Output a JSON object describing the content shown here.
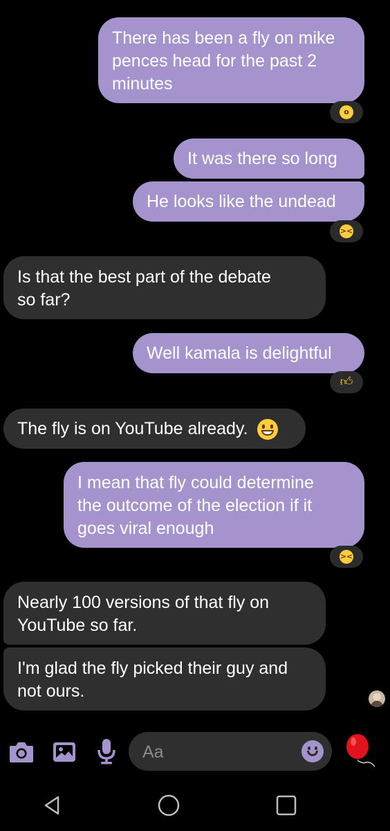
{
  "messages": [
    {
      "lines": [
        "There has been a fly on mike",
        "pences head for the past 2",
        "minutes"
      ],
      "reaction": "astonished-face"
    },
    {
      "lines": [
        "It was there so long"
      ]
    },
    {
      "lines": [
        "He looks like the undead"
      ],
      "reaction": "laughing-face"
    },
    {
      "lines": [
        "Is that the best part of the debate",
        "so far?"
      ]
    },
    {
      "lines": [
        "Well kamala is delightful"
      ],
      "reaction": "thumbs-up"
    },
    {
      "lines": [
        "The fly is on YouTube already. "
      ],
      "emoji": "grinning-face"
    },
    {
      "lines": [
        "I mean that fly could determine",
        "the outcome of the election if it",
        "goes viral enough"
      ],
      "reaction": "laughing-face"
    },
    {
      "lines": [
        "Nearly 100 versions of that fly on",
        "YouTube so far."
      ]
    },
    {
      "lines": [
        "I'm glad the fly picked their guy and",
        "not ours."
      ]
    }
  ],
  "composer": {
    "placeholder": "Aa",
    "icons": [
      "camera-icon",
      "gallery-icon",
      "microphone-icon",
      "emoji-icon",
      "balloon-icon"
    ]
  },
  "navbar": {
    "icons": [
      "back-icon",
      "home-icon",
      "recents-icon"
    ]
  },
  "colors": {
    "outgoing_bubble": "#a493cc",
    "incoming_bubble": "#2f2f2f",
    "accent": "#a493cc",
    "background": "#000000"
  }
}
